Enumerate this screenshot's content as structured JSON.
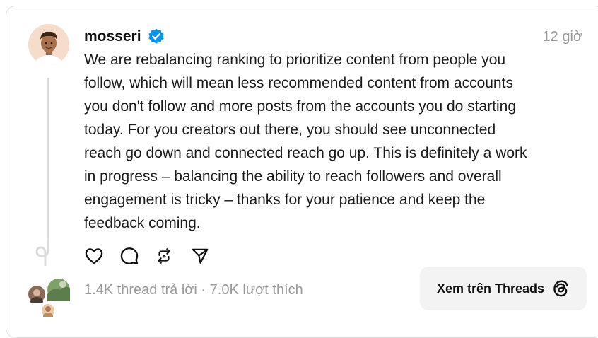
{
  "post": {
    "username": "mosseri",
    "verified": true,
    "timestamp": "12 giờ",
    "text": "We are rebalancing ranking to prioritize content from people you\nfollow, which will mean less recommended content from accounts\nyou don't follow and more posts from the accounts you do starting\ntoday. For you creators out there, you should see unconnected\nreach go down and connected reach go up. This is definitely a work\nin progress – balancing the ability to reach followers and overall\nengagement is tricky – thanks for your patience and keep the\nfeedback coming."
  },
  "actions": {
    "like_icon": "heart-icon",
    "reply_icon": "comment-icon",
    "repost_icon": "repost-icon",
    "share_icon": "send-icon"
  },
  "footer": {
    "stats": "1.4K thread trả lời · 7.0K lượt thích",
    "view_button_label": "Xem trên Threads"
  },
  "colors": {
    "verified": "#0095f6",
    "muted": "#999999",
    "button_bg": "#f3f3f3"
  }
}
